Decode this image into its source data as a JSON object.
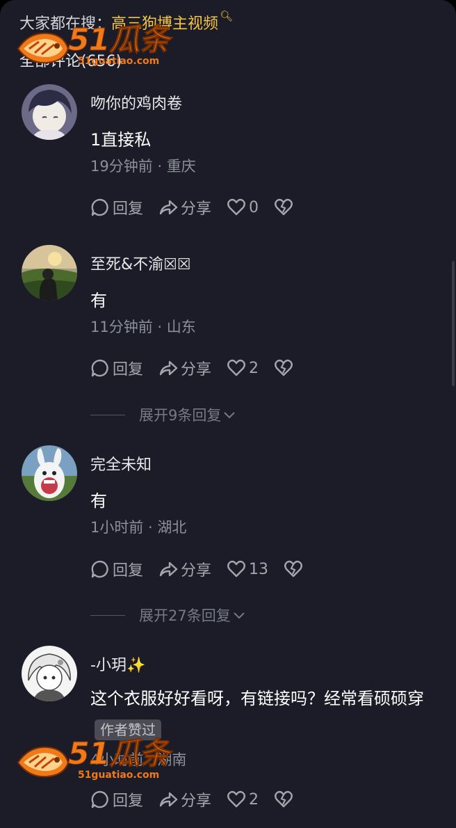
{
  "search": {
    "prefix": "大家都在搜：",
    "keyword": "高三狗博主视频"
  },
  "comments_title": "全部评论(656)",
  "watermark": {
    "brand": "51瓜条",
    "url": "51guatiao.com"
  },
  "action_labels": {
    "reply": "回复",
    "share": "分享"
  },
  "comments": [
    {
      "username": "吻你的鸡肉卷",
      "text": "1直接私",
      "time": "19分钟前",
      "location": "重庆",
      "likes": "0"
    },
    {
      "username": "至死&不渝☒☒",
      "text": "有",
      "time": "11分钟前",
      "location": "山东",
      "likes": "2",
      "expand": "展开9条回复"
    },
    {
      "username": "完全未知",
      "text": "有",
      "time": "1小时前",
      "location": "湖北",
      "likes": "13",
      "expand": "展开27条回复"
    },
    {
      "username": "-小玥✨",
      "text": "这个衣服好好看呀，有链接吗？经常看硕硕穿",
      "badge": "作者赞过",
      "time": "4小时前",
      "location": "湖南",
      "likes": "2"
    }
  ],
  "colors": {
    "background": "#1b1c27",
    "keyword": "#f4c544",
    "watermark": "#f07a1a"
  }
}
